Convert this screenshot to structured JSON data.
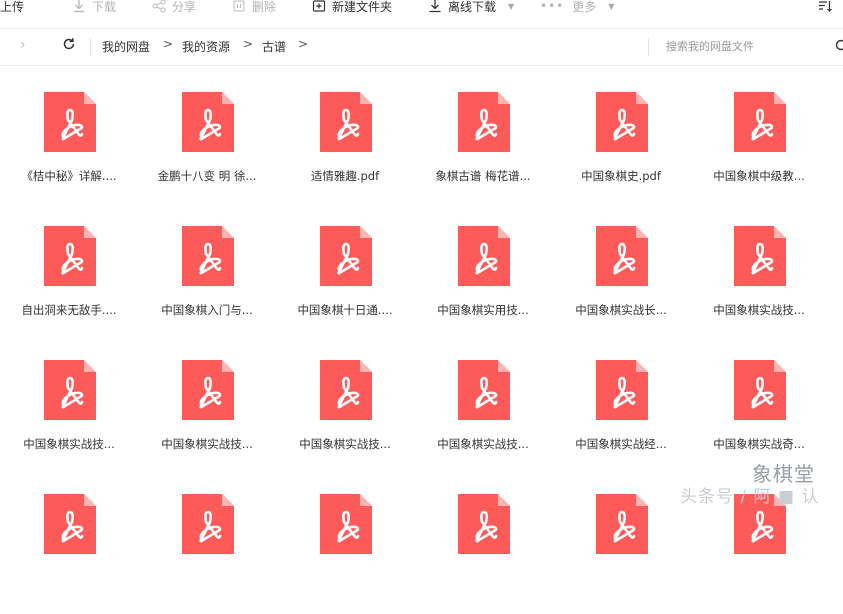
{
  "toolbar": {
    "upload": "上传",
    "download": "下载",
    "share": "分享",
    "delete": "删除",
    "new_folder": "新建文件夹",
    "offline_download": "离线下载",
    "more": "更多"
  },
  "nav": {
    "breadcrumbs": [
      "我的网盘",
      "我的资源",
      "古谱"
    ],
    "search_placeholder": "搜索我的网盘文件"
  },
  "files": [
    "《桔中秘》详解....",
    "金鹏十八变 明 徐...",
    "适情雅趣.pdf",
    "象棋古谱  梅花谱...",
    "中国象棋史.pdf",
    "中国象棋中级教...",
    "自出洞来无敌手....",
    "中国象棋入门与...",
    "中国象棋十日通....",
    "中国象棋实用技...",
    "中国象棋实战长...",
    "中国象棋实战技...",
    "中国象棋实战技...",
    "中国象棋实战技...",
    "中国象棋实战技...",
    "中国象棋实战技...",
    "中国象棋实战经...",
    "中国象棋实战奇...",
    "",
    "",
    "",
    "",
    "",
    ""
  ],
  "watermark": {
    "line1": "象棋堂",
    "line2": "头条号 / 阿 ■ 认"
  },
  "colors": {
    "pdf_red": "#ff5a5a",
    "pdf_fold": "#ffb3b3"
  }
}
